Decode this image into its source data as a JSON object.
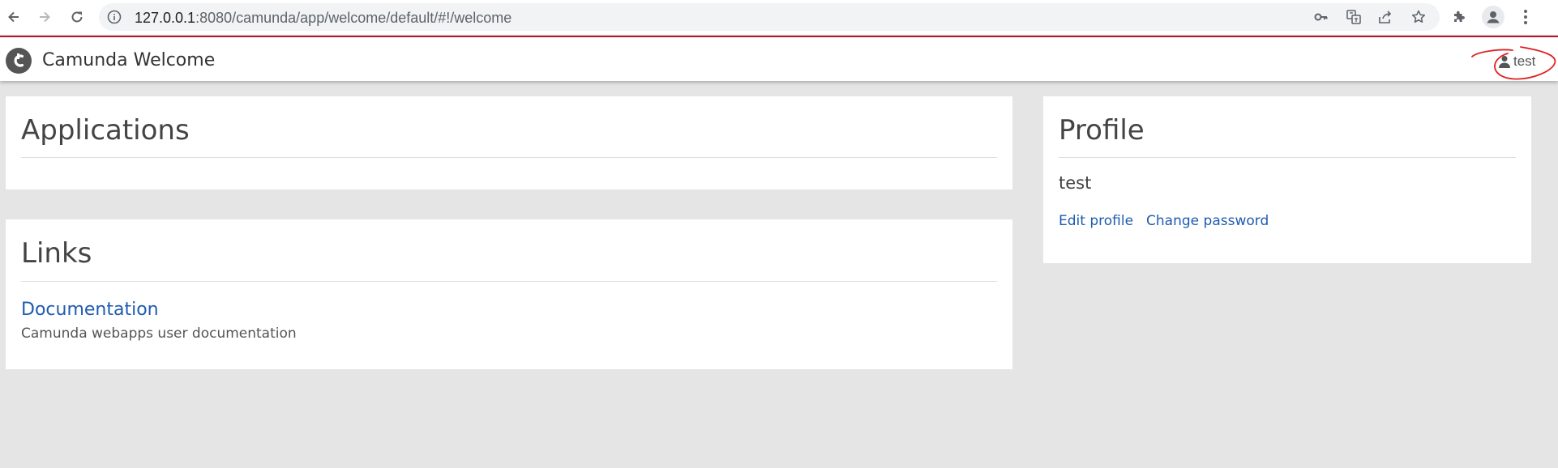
{
  "browser": {
    "url_host": "127.0.0.1",
    "url_rest": ":8080/camunda/app/welcome/default/#!/welcome"
  },
  "header": {
    "title": "Camunda Welcome",
    "user_label": "test",
    "accent_color": "#b5152b"
  },
  "applications": {
    "title": "Applications"
  },
  "links": {
    "title": "Links",
    "items": [
      {
        "label": "Documentation",
        "description": "Camunda webapps user documentation"
      }
    ]
  },
  "profile": {
    "title": "Profile",
    "name": "test",
    "edit_label": "Edit profile",
    "password_label": "Change password"
  },
  "icons": [
    "back-arrow-icon",
    "forward-arrow-icon",
    "reload-icon",
    "site-info-icon",
    "key-icon",
    "translate-icon",
    "share-icon",
    "star-icon",
    "extensions-icon",
    "profile-icon",
    "more-icon",
    "camunda-logo-icon",
    "user-icon"
  ]
}
